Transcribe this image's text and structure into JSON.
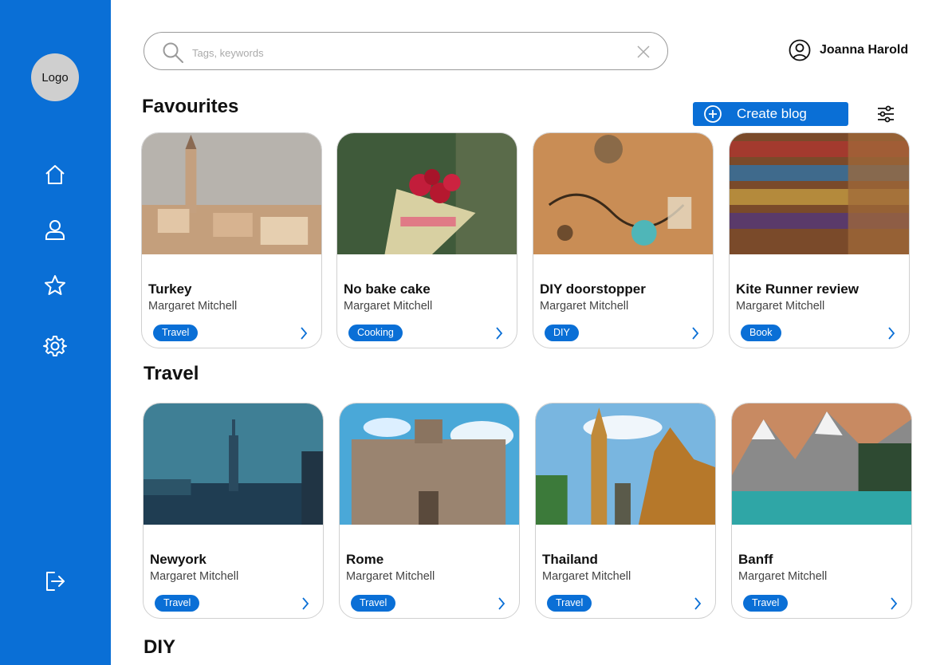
{
  "sidebar": {
    "logo_label": "Logo",
    "nav": [
      {
        "icon": "home-icon"
      },
      {
        "icon": "user-icon"
      },
      {
        "icon": "star-icon"
      },
      {
        "icon": "gear-icon"
      }
    ],
    "logout_icon": "logout-icon"
  },
  "search": {
    "placeholder": "Tags, keywords",
    "value": ""
  },
  "user": {
    "name": "Joanna Harold"
  },
  "toolbar": {
    "create_label": "Create blog"
  },
  "sections": {
    "favourites": {
      "title": "Favourites",
      "cards": [
        {
          "title": "Turkey",
          "author": "Margaret Mitchell",
          "tag": "Travel"
        },
        {
          "title": "No bake cake",
          "author": "Margaret Mitchell",
          "tag": "Cooking"
        },
        {
          "title": "DIY doorstopper",
          "author": "Margaret Mitchell",
          "tag": "DIY"
        },
        {
          "title": "Kite Runner review",
          "author": "Margaret Mitchell",
          "tag": "Book"
        }
      ]
    },
    "travel": {
      "title": "Travel",
      "cards": [
        {
          "title": "Newyork",
          "author": "Margaret Mitchell",
          "tag": "Travel"
        },
        {
          "title": "Rome",
          "author": "Margaret Mitchell",
          "tag": "Travel"
        },
        {
          "title": "Thailand",
          "author": "Margaret Mitchell",
          "tag": "Travel"
        },
        {
          "title": "Banff",
          "author": "Margaret Mitchell",
          "tag": "Travel"
        }
      ]
    },
    "diy": {
      "title": "DIY"
    }
  },
  "colors": {
    "accent": "#0a6fd6",
    "sidebar": "#0a6fd6",
    "logo_bg": "#cfcfcf"
  }
}
